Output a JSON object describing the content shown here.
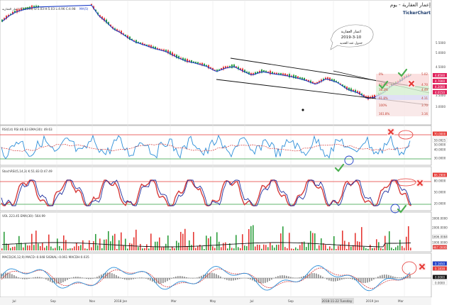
{
  "window": {
    "title": "إعمار العقارية - يوم",
    "brand": "TickerChart"
  },
  "price_panel": {
    "legend": "إعمار العقارية (EMAAR) O:5.03 H:5.03 L:4.96 C:4.98",
    "ma_label": "MA(5)",
    "annotation_lines": [
      "اعمار العقارية",
      "2019-3-10",
      "جدول عند الحديد"
    ],
    "axis_ticks": [
      "5.5000",
      "5.0000",
      "4.5000",
      "4.0000",
      "3.5000",
      "3.0000"
    ],
    "fib_levels": [
      {
        "label": "0%",
        "value": "5.02"
      },
      {
        "label": "23.6%",
        "value": "4.70"
      },
      {
        "label": "38.2%",
        "value": "4.49"
      },
      {
        "label": "61.8%",
        "value": "4.11"
      },
      {
        "label": "100%",
        "value": "3.70"
      },
      {
        "label": "161.8%",
        "value": "3.16"
      }
    ],
    "price_badges": [
      {
        "text": "4.8500",
        "color": "#e0245e"
      },
      {
        "text": "4.7000",
        "color": "#e0245e"
      },
      {
        "text": "4.2000",
        "color": "#e0245e"
      },
      {
        "text": "4.0150",
        "color": "#e0245e"
      }
    ]
  },
  "rsi_panel": {
    "legend": "RSI(14) RSI:46.63 EMA(30): 49.63",
    "levels": [
      "70.0000",
      "59.0925",
      "50.0000",
      "40.0000",
      "30.0000"
    ]
  },
  "stoch_panel": {
    "legend": "StochRSI(5,14,3) K:51.83 D:47.49",
    "levels": [
      "86.2900",
      "80.0000",
      "50.0000",
      "20.0000"
    ]
  },
  "vol_panel": {
    "legend": "VOL 223.45 EMA(30): 564.99",
    "levels": [
      "3000.0000",
      "2000.0000",
      "1696.0084",
      "1000.0000",
      "467.0000"
    ]
  },
  "macd_panel": {
    "legend": "MACD(26,12,9) MACD:-0.048 SIGNAL:-0.061 MACDH:0.035",
    "levels": [
      "0.1650",
      "0.1838",
      "0.0000",
      "0.0000"
    ]
  },
  "x_axis_ticks": [
    "Jul",
    "Sep",
    "Nov",
    "2018 Jan",
    "Mar",
    "May",
    "Jul",
    "Sep",
    "2018-11-22 Tuesday",
    "2019 Jan",
    "Mar"
  ],
  "marks": {
    "check_color": "#4caf50",
    "cross_color": "#e53935",
    "circle_blue": "#1e3fc8",
    "circle_red": "#e53935"
  }
}
